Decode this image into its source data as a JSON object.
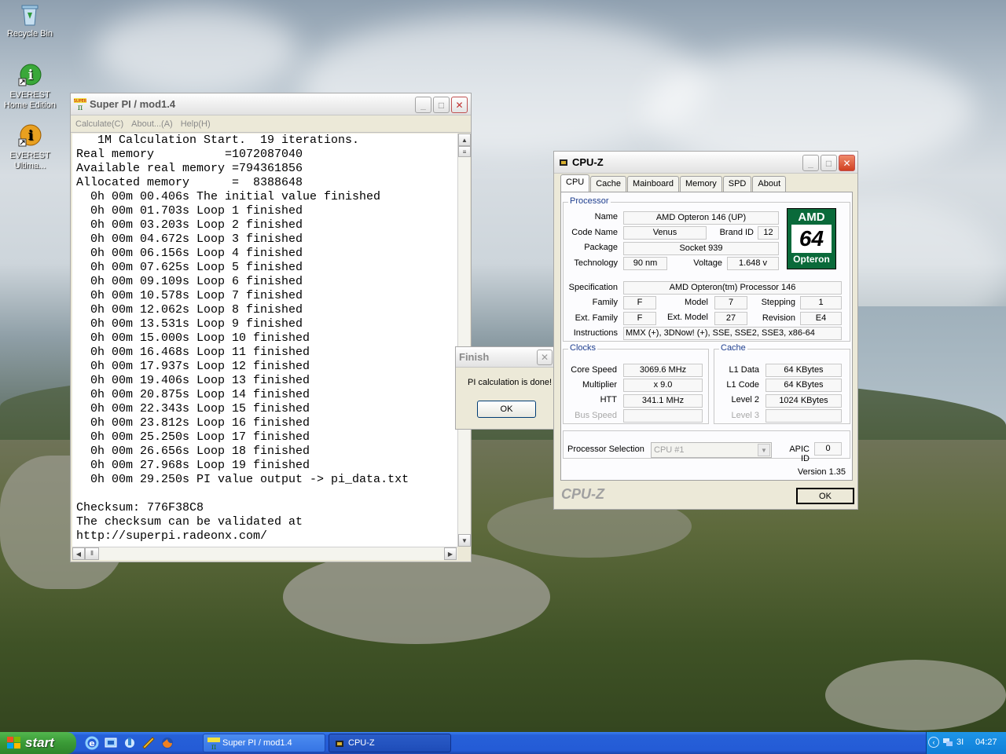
{
  "desktop": {
    "icons": [
      {
        "label": "Recycle Bin"
      },
      {
        "label": "EVEREST Home Edition"
      },
      {
        "label": "EVEREST Ultima..."
      }
    ]
  },
  "superpi": {
    "title": "Super PI / mod1.4",
    "menu": [
      "Calculate(C)",
      "About...(A)",
      "Help(H)"
    ],
    "output_lines": [
      "   1M Calculation Start.  19 iterations.",
      "Real memory          =1072087040",
      "Available real memory =794361856",
      "Allocated memory      =  8388648",
      "  0h 00m 00.406s The initial value finished",
      "  0h 00m 01.703s Loop 1 finished",
      "  0h 00m 03.203s Loop 2 finished",
      "  0h 00m 04.672s Loop 3 finished",
      "  0h 00m 06.156s Loop 4 finished",
      "  0h 00m 07.625s Loop 5 finished",
      "  0h 00m 09.109s Loop 6 finished",
      "  0h 00m 10.578s Loop 7 finished",
      "  0h 00m 12.062s Loop 8 finished",
      "  0h 00m 13.531s Loop 9 finished",
      "  0h 00m 15.000s Loop 10 finished",
      "  0h 00m 16.468s Loop 11 finished",
      "  0h 00m 17.937s Loop 12 finished",
      "  0h 00m 19.406s Loop 13 finished",
      "  0h 00m 20.875s Loop 14 finished",
      "  0h 00m 22.343s Loop 15 finished",
      "  0h 00m 23.812s Loop 16 finished",
      "  0h 00m 25.250s Loop 17 finished",
      "  0h 00m 26.656s Loop 18 finished",
      "  0h 00m 27.968s Loop 19 finished",
      "  0h 00m 29.250s PI value output -> pi_data.txt",
      "",
      "Checksum: 776F38C8",
      "The checksum can be validated at",
      "http://superpi.radeonx.com/"
    ]
  },
  "finish": {
    "title": "Finish",
    "message": "PI calculation is done!",
    "ok": "OK"
  },
  "cpuz": {
    "title": "CPU-Z",
    "tabs": [
      "CPU",
      "Cache",
      "Mainboard",
      "Memory",
      "SPD",
      "About"
    ],
    "active_tab": "CPU",
    "processor": {
      "group": "Processor",
      "name_label": "Name",
      "name": "AMD Opteron 146 (UP)",
      "codename_label": "Code Name",
      "codename": "Venus",
      "brandid_label": "Brand ID",
      "brandid": "12",
      "package_label": "Package",
      "package": "Socket 939",
      "technology_label": "Technology",
      "technology": "90 nm",
      "voltage_label": "Voltage",
      "voltage": "1.648 v",
      "spec_label": "Specification",
      "spec": "AMD Opteron(tm) Processor 146",
      "family_label": "Family",
      "family": "F",
      "model_label": "Model",
      "model": "7",
      "stepping_label": "Stepping",
      "stepping": "1",
      "extfamily_label": "Ext. Family",
      "extfamily": "F",
      "extmodel_label": "Ext. Model",
      "extmodel": "27",
      "revision_label": "Revision",
      "revision": "E4",
      "instructions_label": "Instructions",
      "instructions": "MMX (+), 3DNow! (+), SSE, SSE2, SSE3, x86-64",
      "logo": {
        "brand": "AMD",
        "bits": "64",
        "line": "Opteron"
      }
    },
    "clocks": {
      "group": "Clocks",
      "corespeed_label": "Core Speed",
      "corespeed": "3069.6 MHz",
      "multiplier_label": "Multiplier",
      "multiplier": "x 9.0",
      "htt_label": "HTT",
      "htt": "341.1 MHz",
      "busspeed_label": "Bus Speed",
      "busspeed": ""
    },
    "cache": {
      "group": "Cache",
      "l1data_label": "L1 Data",
      "l1data": "64 KBytes",
      "l1code_label": "L1 Code",
      "l1code": "64 KBytes",
      "level2_label": "Level 2",
      "level2": "1024 KBytes",
      "level3_label": "Level 3",
      "level3": ""
    },
    "selection_label": "Processor Selection",
    "selection": "CPU #1",
    "apic_label": "APIC ID",
    "apic": "0",
    "version": "Version 1.35",
    "brand_footer": "CPU-Z",
    "ok": "OK"
  },
  "taskbar": {
    "start": "start",
    "tasks": [
      "Super PI / mod1.4",
      "CPU-Z"
    ],
    "tray_text": "3I",
    "clock": "04:27"
  }
}
